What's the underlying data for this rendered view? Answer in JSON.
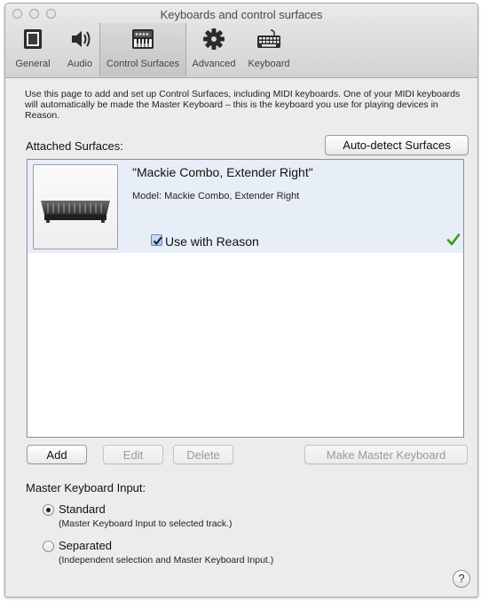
{
  "window": {
    "title": "Keyboards and control surfaces"
  },
  "toolbar": {
    "items": [
      {
        "label": "General",
        "icon": "general-icon"
      },
      {
        "label": "Audio",
        "icon": "speaker-icon"
      },
      {
        "label": "Control Surfaces",
        "icon": "keyboard-controller-icon",
        "selected": true
      },
      {
        "label": "Advanced",
        "icon": "gear-icon"
      },
      {
        "label": "Keyboard",
        "icon": "keyboard-icon"
      }
    ]
  },
  "description": "Use this page to add and set up Control Surfaces, including MIDI keyboards. One of your MIDI keyboards will automatically be made the Master Keyboard – this is the keyboard you use for playing devices in Reason.",
  "attached_surfaces": {
    "label": "Attached Surfaces:",
    "autodetect_label": "Auto-detect Surfaces",
    "items": [
      {
        "name": "\"Mackie Combo, Extender Right\"",
        "model": "Model: Mackie Combo, Extender Right",
        "use_with_reason_label": "Use with Reason",
        "use_with_reason": true,
        "status_icon": "checkmark-icon"
      }
    ]
  },
  "buttons": {
    "add": "Add",
    "edit": "Edit",
    "delete": "Delete",
    "make_master": "Make Master Keyboard"
  },
  "master_keyboard_input": {
    "label": "Master Keyboard Input:",
    "options": [
      {
        "label": "Standard",
        "description": "(Master Keyboard Input to selected track.)",
        "selected": true
      },
      {
        "label": "Separated",
        "description": "(Independent selection and Master Keyboard Input.)",
        "selected": false
      }
    ]
  },
  "help_label": "?",
  "colors": {
    "window_bg": "#ececec",
    "selection_bg": "#e8eef8",
    "check_green": "#3a9a1c"
  }
}
